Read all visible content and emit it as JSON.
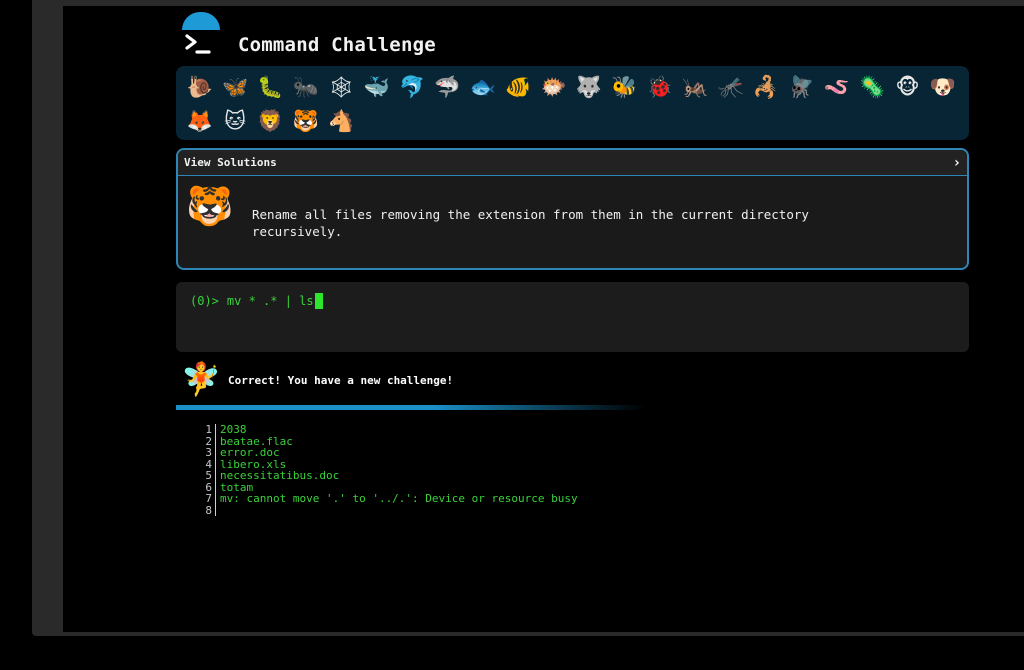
{
  "app": {
    "title": "Command Challenge"
  },
  "emojis": {
    "row1": [
      "🐌",
      "🦋",
      "🐛",
      "🐜",
      "🕸",
      "🐳",
      "🐬",
      "🦈",
      "🐟",
      "🐠",
      "🐡",
      "🐺",
      "🐝",
      "🐞",
      "🦗",
      "🦟",
      "🦂",
      "🪰",
      "🪱",
      "🦠",
      "🐵",
      "🐶"
    ],
    "row2": [
      "🦊",
      "🐱",
      "🦁",
      "🐯",
      "🐴"
    ]
  },
  "solutions": {
    "label": "View Solutions",
    "chevron": "›",
    "challenge_text": "Rename all files removing the extension from them in the current directory\nrecursively."
  },
  "terminal": {
    "prompt": "(0)>",
    "command": "mv * .* | ls"
  },
  "feedback": {
    "message": "Correct! You have a new challenge!"
  },
  "output": {
    "lines": [
      {
        "n": "1",
        "text": "2038"
      },
      {
        "n": "2",
        "text": "beatae.flac"
      },
      {
        "n": "3",
        "text": "error.doc"
      },
      {
        "n": "4",
        "text": "libero.xls"
      },
      {
        "n": "5",
        "text": "necessitatibus.doc"
      },
      {
        "n": "6",
        "text": "totam"
      },
      {
        "n": "7",
        "text": "mv: cannot move '.' to '../.': Device or resource busy"
      },
      {
        "n": "8",
        "text": ""
      }
    ]
  },
  "colors": {
    "accent": "#1e9bd7",
    "terminal_green": "#3ad13a",
    "panel_bg": "#072535"
  }
}
